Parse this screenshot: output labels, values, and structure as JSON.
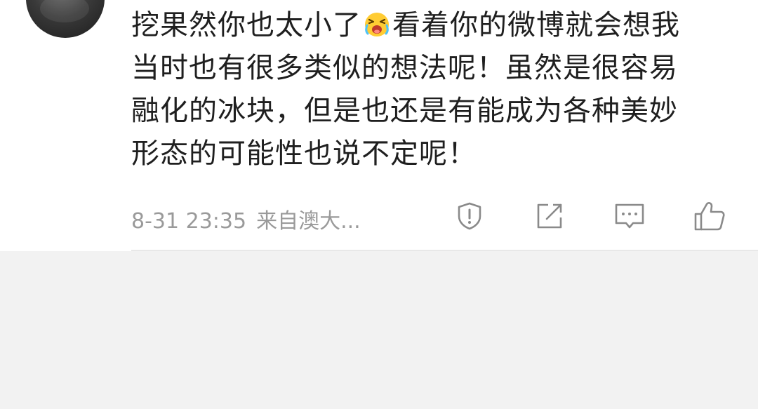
{
  "comment": {
    "lines": [
      "挖果然你也太小了",
      "看着你的微博就会想我",
      "当时也有很多类似的想法呢！虽然是很容易",
      "融化的冰块，但是也还是有能成为各种美妙",
      "形态的可能性也说不定呢！"
    ],
    "emoji": "crying-face-emoji",
    "timestamp": "8-31 23:35",
    "source": "来自澳大..."
  },
  "actions": {
    "report_icon": "shield-alert-icon",
    "repost_icon": "share-edit-icon",
    "comment_icon": "comment-bubble-icon",
    "like_icon": "thumbs-up-icon"
  },
  "colors": {
    "text": "#1f1f1f",
    "meta": "#9a9a9a",
    "icon": "#8a8a8a",
    "background": "#f2f2f2"
  }
}
